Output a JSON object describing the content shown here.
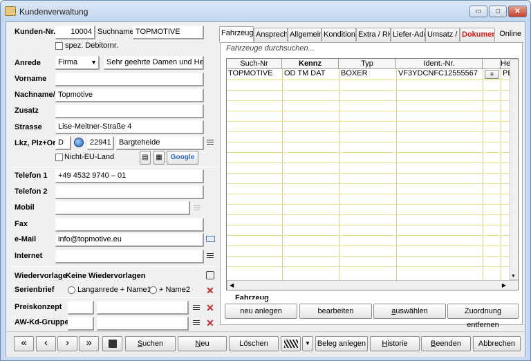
{
  "window": {
    "title": "Kundenverwaltung",
    "minimize": "▭",
    "maximize": "□",
    "close": "✕"
  },
  "left": {
    "kunden_nr_label": "Kunden-Nr.",
    "kunden_nr_value": "10004",
    "suchname_label": "Suchname",
    "suchname_value": "TOPMOTIVE",
    "spez_debitor_label": "spez. Debitornr.",
    "anrede_label": "Anrede",
    "anrede_value": "Firma",
    "anrede_text": "Sehr geehrte Damen und Herre",
    "vorname_label": "Vorname",
    "vorname_value": "",
    "nachname_label": "Nachname/F",
    "nachname_value": "Topmotive",
    "zusatz_label": "Zusatz",
    "zusatz_value": "",
    "strasse_label": "Strasse",
    "strasse_value": "Lise-Meitner-Straße 4",
    "lkz_label": "Lkz, Plz+Ort",
    "lkz_value": "D",
    "plz_value": "22941",
    "ort_value": "Bargteheide",
    "nicht_eu_label": "Nicht-EU-Land",
    "google_label": "Google",
    "telefon1_label": "Telefon 1",
    "telefon1_value": "+49 4532 9740 – 01",
    "telefon2_label": "Telefon 2",
    "telefon2_value": "",
    "mobil_label": "Mobil",
    "mobil_value": "",
    "fax_label": "Fax",
    "fax_value": "",
    "email_label": "e-Mail",
    "email_value": "info@topmotive.eu",
    "internet_label": "Internet",
    "internet_value": "",
    "wiedervorlage_label": "Wiedervorlage",
    "wiedervorlage_value": "Keine Wiedervorlagen",
    "serienbrief_label": "Serienbrief",
    "serienbrief_opt1": "Langanrede + Name1",
    "serienbrief_opt2": "+ Name2",
    "preiskonzept_label": "Preiskonzept",
    "awkd_label": "AW-Kd-Gruppe"
  },
  "tabs": [
    {
      "label": "Fahrzeuge"
    },
    {
      "label": "Ansprechi"
    },
    {
      "label": "Allgemein"
    },
    {
      "label": "Kondition-"
    },
    {
      "label": "Extra / RK"
    },
    {
      "label": "Liefer-Adr"
    },
    {
      "label": "Umsatz / I"
    },
    {
      "label": "Dokumen"
    },
    {
      "label": "Online"
    }
  ],
  "vehicles": {
    "search_hint": "Fahrzeuge durchsuchen...",
    "columns": [
      "Such-Nr",
      "Kennz",
      "Typ",
      "Ident.-Nr.",
      "",
      "He"
    ],
    "rows": [
      {
        "such_nr": "TOPMOTIVE",
        "kennz": "OD TM DAT",
        "typ": "BOXER",
        "ident": "VF3YDCNFC12555567",
        "extra": "PE"
      }
    ],
    "group_title": "Fahrzeug",
    "btn_new": "neu anlegen",
    "btn_edit": "bearbeiten",
    "btn_select": "auswählen",
    "btn_unassign": "Zuordnung entfernen"
  },
  "toolbar": {
    "first": "«",
    "prev": "‹",
    "next": "›",
    "last": "»",
    "suchen": "Suchen",
    "neu": "Neu",
    "loeschen": "Löschen",
    "beleg": "Beleg anlegen",
    "historie": "Historie",
    "beenden": "Beenden",
    "abbrechen": "Abbrechen"
  },
  "colors": {
    "accent_red": "#d21818",
    "grid_line": "#d4d27a",
    "titlebar": "#c1d5ee"
  }
}
